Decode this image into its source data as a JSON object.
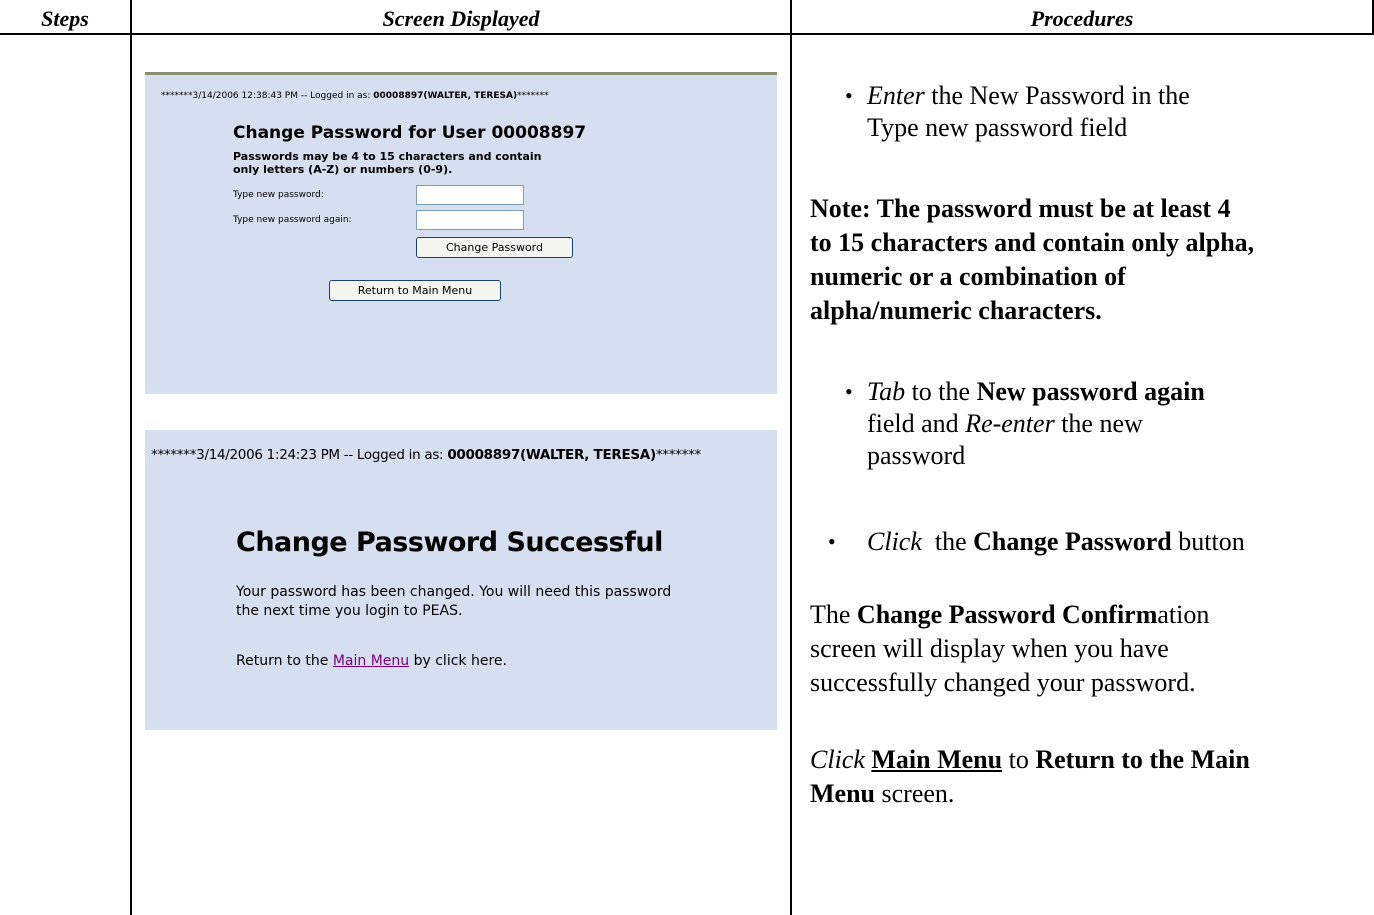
{
  "table": {
    "headers": [
      "Steps",
      "Screen Displayed",
      "Procedures"
    ]
  },
  "screen1": {
    "login_prefix": "*******3/14/2006 12:38:43 PM -- Logged in as: ",
    "login_user": "00008897(WALTER, TERESA)",
    "login_suffix": "*******",
    "title": "Change Password for User 00008897",
    "help_line1": "Passwords may be 4 to 15 characters and contain",
    "help_line2": "only letters (A-Z) or numbers (0-9).",
    "label_new": "Type new password:",
    "label_again": "Type new password again:",
    "change_button": "Change Password",
    "return_button": "Return to Main Menu"
  },
  "screen2": {
    "login_prefix": "*******3/14/2006 1:24:23 PM -- Logged in as: ",
    "login_user": "00008897(WALTER, TERESA)",
    "login_suffix": "*******",
    "title": "Change Password Successful",
    "text_line1": "Your password has been changed.  You will need this password",
    "text_line2": "the next time you login to PEAS.",
    "return_prefix": "Return to the ",
    "return_link": "Main Menu",
    "return_suffix": " by click here."
  },
  "procedures": {
    "b1_verb": "Enter",
    "b1_rest1": " the New Password in the",
    "b1_rest2": "Type new password field",
    "note_line1": "Note: The password must be at least 4",
    "note_line2": "to 15 characters and contain only alpha,",
    "note_line3": "numeric or a combination of",
    "note_line4": "alpha/numeric characters.",
    "b2_verb": "Tab",
    "b2_to": " to the ",
    "b2_bold": "New password again",
    "b2_line2_pre": "field and ",
    "b2_line2_verb": "Re-enter",
    "b2_line2_post": " the new",
    "b2_line3": "password",
    "b3_verb": "Click",
    "b3_the": "  the ",
    "b3_bold": "Change Password",
    "b3_post": " button",
    "conf_the": "The ",
    "conf_bold": "Change Password Confirm",
    "conf_rest": "ation",
    "conf_line2": "screen will display when you have",
    "conf_line3": "successfully changed your password.",
    "final_verb": "Click",
    "final_link": "Main Menu",
    "final_to": " to ",
    "final_bold1": "Return to the Main",
    "final_bold2": "Menu",
    "final_post": " screen."
  }
}
